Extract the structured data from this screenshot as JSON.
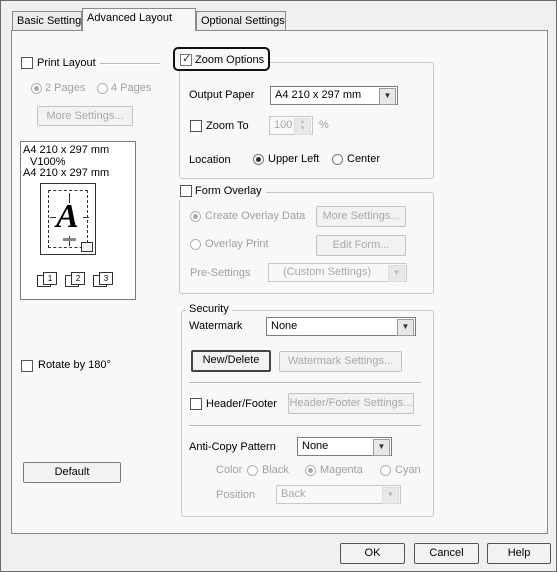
{
  "tabs": [
    {
      "label": "Basic Settings"
    },
    {
      "label": "Advanced Layout"
    },
    {
      "label": "Optional Settings"
    }
  ],
  "print_layout": {
    "label": "Print Layout",
    "pages_2": "2 Pages",
    "pages_4": "4 Pages",
    "more_settings": "More Settings..."
  },
  "preview": {
    "line1": "A4 210 x 297 mm",
    "line2": "V100%",
    "line3": "A4 210 x 297 mm",
    "glyph": "A",
    "mini1": "1",
    "mini2": "2",
    "mini3": "3"
  },
  "rotate": {
    "label": "Rotate by 180°"
  },
  "default_button": "Default",
  "zoom": {
    "label": "Zoom Options",
    "output_paper_label": "Output Paper",
    "output_paper_value": "A4 210 x 297 mm",
    "zoom_to_label": "Zoom To",
    "zoom_to_value": "100",
    "percent": "%",
    "location_label": "Location",
    "upper_left": "Upper Left",
    "center": "Center"
  },
  "form_overlay": {
    "label": "Form Overlay",
    "create": "Create Overlay Data",
    "more_settings": "More Settings...",
    "print": "Overlay Print",
    "edit_form": "Edit Form...",
    "pre_settings_label": "Pre-Settings",
    "pre_settings_value": "(Custom Settings)"
  },
  "security": {
    "legend": "Security",
    "watermark_label": "Watermark",
    "watermark_value": "None",
    "new_delete": "New/Delete",
    "watermark_settings": "Watermark Settings...",
    "header_footer_label": "Header/Footer",
    "header_footer_settings": "Header/Footer Settings...",
    "anti_copy_label": "Anti-Copy Pattern",
    "anti_copy_value": "None",
    "color_label": "Color",
    "black": "Black",
    "magenta": "Magenta",
    "cyan": "Cyan",
    "position_label": "Position",
    "position_value": "Back"
  },
  "footer": {
    "ok": "OK",
    "cancel": "Cancel",
    "help": "Help"
  }
}
